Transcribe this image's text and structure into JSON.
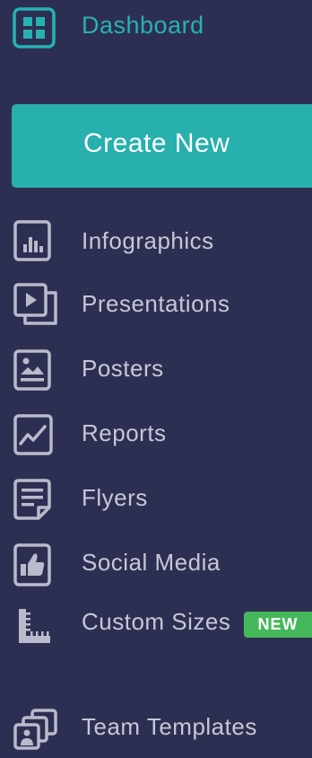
{
  "dashboard": {
    "label": "Dashboard",
    "icon": "dashboard-grid-icon",
    "color": "#26b2b3"
  },
  "create_button": {
    "label": "Create New",
    "color": "#27b0ad"
  },
  "nav_items": [
    {
      "label": "Infographics",
      "icon": "infographic-chart-icon"
    },
    {
      "label": "Presentations",
      "icon": "presentation-play-icon"
    },
    {
      "label": "Posters",
      "icon": "poster-image-icon"
    },
    {
      "label": "Reports",
      "icon": "report-line-chart-icon"
    },
    {
      "label": "Flyers",
      "icon": "flyer-document-icon"
    },
    {
      "label": "Social Media",
      "icon": "social-thumbs-up-icon"
    },
    {
      "label": "Custom Sizes",
      "icon": "ruler-icon",
      "badge": "NEW"
    },
    {
      "label": "Team Templates",
      "icon": "team-templates-icon"
    }
  ],
  "colors": {
    "background": "#2d2f52",
    "item_text": "#c6c7d6",
    "badge": "#45b85c"
  }
}
